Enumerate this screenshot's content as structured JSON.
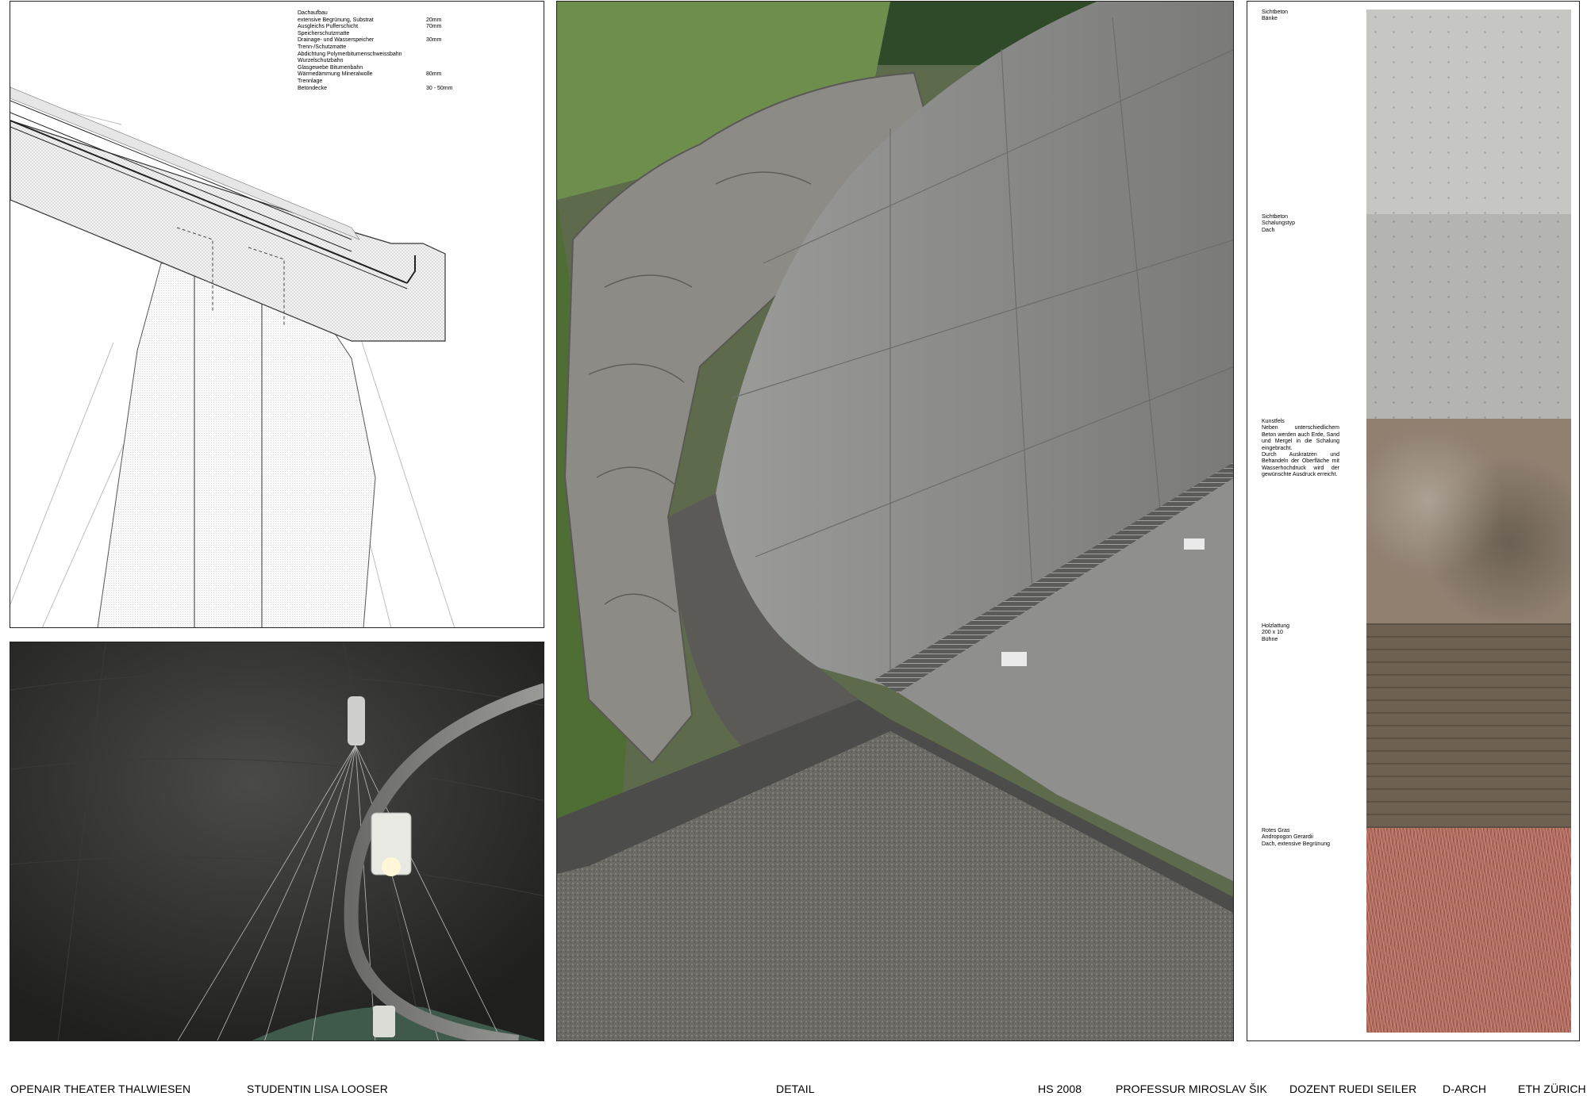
{
  "section": {
    "layers": [
      {
        "label": "Dachaufbau",
        "thickness": ""
      },
      {
        "label": "extensive Begrünung, Substrat",
        "thickness": "20mm"
      },
      {
        "label": "Ausgleichs Pufferschicht",
        "thickness": "70mm"
      },
      {
        "label": "Speicherschutzmatte",
        "thickness": ""
      },
      {
        "label": "Drainage- und Wasserspeicher",
        "thickness": "30mm"
      },
      {
        "label": "Trenn-/Schutzmatte",
        "thickness": ""
      },
      {
        "label": "Abdichtung Polymerbitumenschweissbahn",
        "thickness": ""
      },
      {
        "label": "Wurzelschutzbahn",
        "thickness": ""
      },
      {
        "label": "Glasgewebe Bitumenbahn",
        "thickness": ""
      },
      {
        "label": "Wärmedämmung Mineralwolle",
        "thickness": "80mm"
      },
      {
        "label": "Trennlage",
        "thickness": ""
      },
      {
        "label": "Betondecke",
        "thickness": "30 - 50mm"
      }
    ]
  },
  "materials": [
    {
      "lines": [
        "Sichtbeton",
        "Bänke"
      ],
      "color": "#c6c6c3"
    },
    {
      "lines": [
        "Sichtbeton",
        "Schalungstyp",
        "Dach"
      ],
      "color": "#b4b4b0"
    },
    {
      "lines": [
        "Kunstfels",
        "Neben unterschiedlichem Beton werden auch Erde, Sand und Mergel in die Schalung eingebracht.",
        "Durch Auskratzen und Behandeln der Oberfläche mit Wasserhochdruck wird der gewünschte Ausdruck erreicht."
      ],
      "color": "#8f8070"
    },
    {
      "lines": [
        "Holzlattung",
        "200 x 10",
        "Bühne"
      ],
      "color": "#6e6152"
    },
    {
      "lines": [
        "Rotes Gras",
        "Andropogon Gerardii",
        "Dach, extensive Begrünung"
      ],
      "color": "#b06a5c"
    }
  ],
  "footer": {
    "project": "OPENAIR THEATER THALWIESEN",
    "student": "STUDENTIN LISA LOOSER",
    "sheet": "DETAIL",
    "semester": "HS 2008",
    "professor": "PROFESSUR MIROSLAV ŠIK",
    "lecturer": "DOZENT RUEDI SEILER",
    "department": "D-ARCH",
    "school": "ETH ZÜRICH"
  }
}
